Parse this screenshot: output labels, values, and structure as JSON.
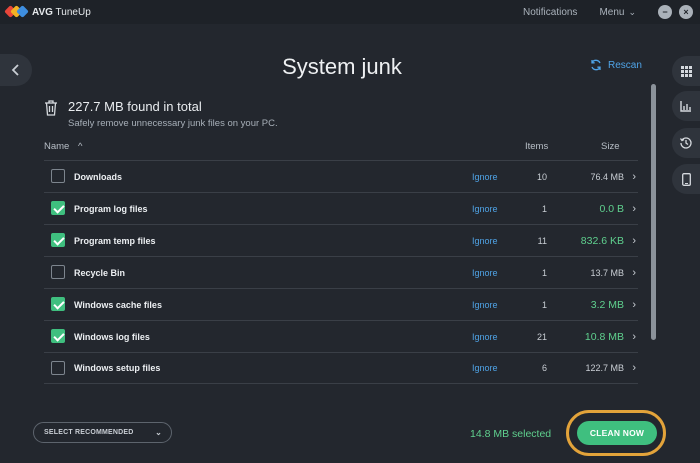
{
  "app": {
    "brand": "AVG",
    "product": "TuneUp"
  },
  "titlebar": {
    "notifications": "Notifications",
    "menu": "Menu",
    "minimize": "−",
    "close": "×"
  },
  "page": {
    "title": "System junk",
    "rescan": "Rescan"
  },
  "summary": {
    "total": "227.7 MB found in total",
    "subtitle": "Safely remove unnecessary junk files on your PC."
  },
  "table": {
    "headers": {
      "name": "Name",
      "sort": "^",
      "items": "Items",
      "size": "Size"
    },
    "ignore_label": "Ignore",
    "rows": [
      {
        "name": "Downloads",
        "checked": false,
        "items": "10",
        "size": "76.4 MB"
      },
      {
        "name": "Program log files",
        "checked": true,
        "items": "1",
        "size": "0.0 B"
      },
      {
        "name": "Program temp files",
        "checked": true,
        "items": "11",
        "size": "832.6 KB"
      },
      {
        "name": "Recycle Bin",
        "checked": false,
        "items": "1",
        "size": "13.7 MB"
      },
      {
        "name": "Windows cache files",
        "checked": true,
        "items": "1",
        "size": "3.2 MB"
      },
      {
        "name": "Windows log files",
        "checked": true,
        "items": "21",
        "size": "10.8 MB"
      },
      {
        "name": "Windows setup files",
        "checked": false,
        "items": "6",
        "size": "122.7 MB"
      }
    ]
  },
  "footer": {
    "select_recommended": "SELECT RECOMMENDED",
    "selected": "14.8 MB selected",
    "clean_now": "CLEAN NOW"
  },
  "icons": {
    "back": "chevron-left-icon",
    "rail": [
      "apps-grid-icon",
      "bar-chart-icon",
      "history-icon",
      "phone-icon"
    ],
    "summary": "trash-icon"
  },
  "colors": {
    "accent_green": "#3fbf7f",
    "link_blue": "#4fa3e6",
    "highlight_ring": "#e3a33a"
  }
}
